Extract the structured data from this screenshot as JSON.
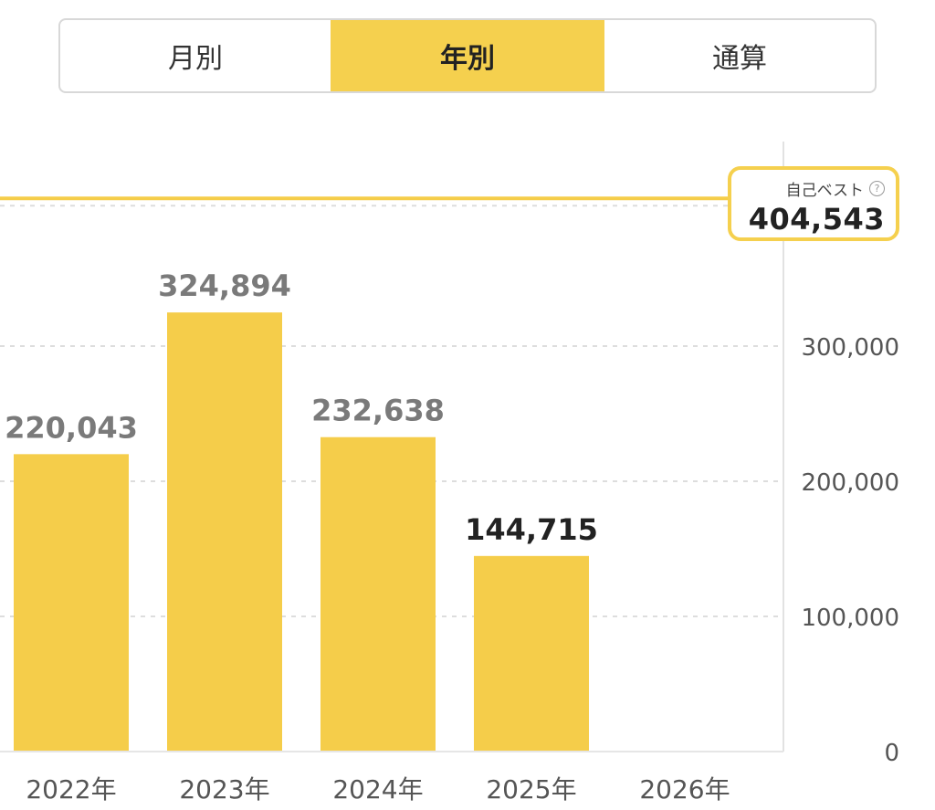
{
  "tabs": [
    {
      "label": "月別",
      "active": false
    },
    {
      "label": "年別",
      "active": true
    },
    {
      "label": "通算",
      "active": false
    }
  ],
  "best": {
    "label": "自己ベスト",
    "icon": "help-circle-icon",
    "value": "404,543",
    "numeric": 404543
  },
  "colors": {
    "bar": "#f5cd4a",
    "best_line": "#f5cd4a",
    "grid": "#dddddd",
    "tick_text": "#555555",
    "value_text": "#7a7a7a",
    "current_value_text": "#222222"
  },
  "chart_data": {
    "type": "bar",
    "categories": [
      "2022年",
      "2023年",
      "2024年",
      "2025年",
      "2026年"
    ],
    "values": [
      220043,
      324894,
      232638,
      144715,
      null
    ],
    "value_labels": [
      "220,043",
      "324,894",
      "232,638",
      "144,715",
      ""
    ],
    "highlighted_index": 3,
    "ylim": [
      0,
      400000
    ],
    "yticks": [
      0,
      100000,
      200000,
      300000
    ],
    "ytick_labels": [
      "0",
      "100,000",
      "200,000",
      "300,000"
    ],
    "reference_line": {
      "label": "自己ベスト",
      "value": 404543
    },
    "axis_position": "right",
    "grid": true,
    "xlabel": "",
    "ylabel": ""
  }
}
